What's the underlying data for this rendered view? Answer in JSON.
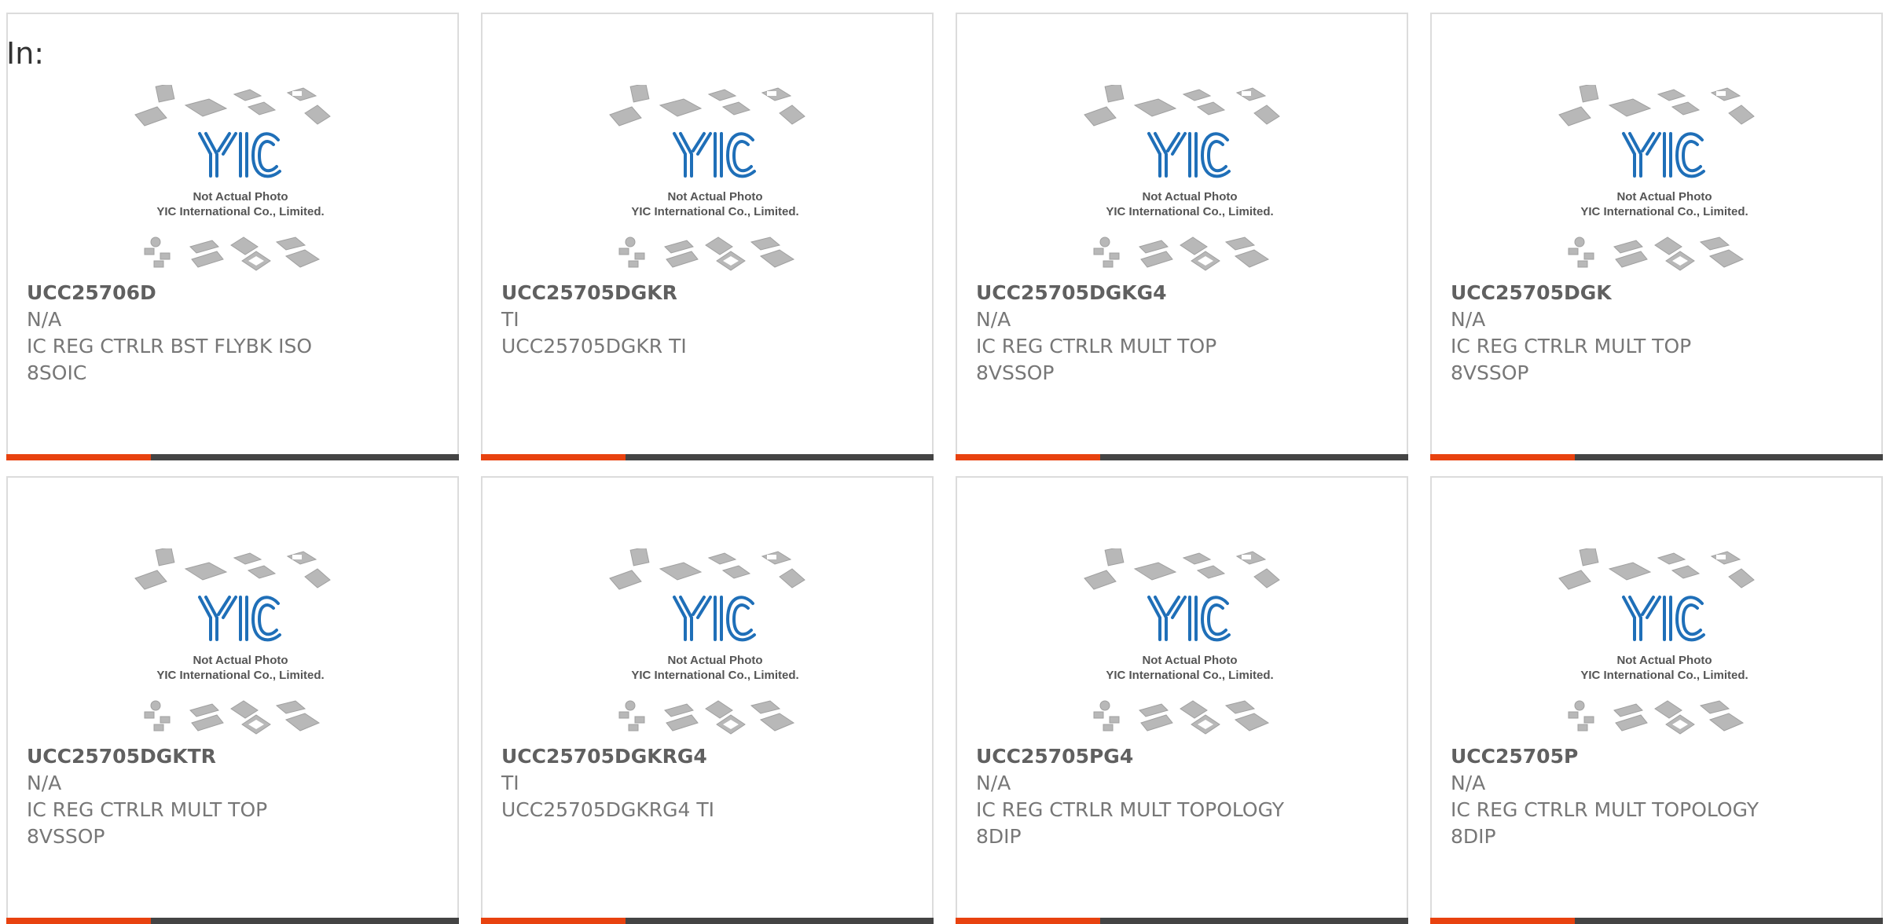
{
  "header": {
    "in_label": "In:"
  },
  "image_text": {
    "line1": "Not Actual Photo",
    "line2": "YIC International Co., Limited."
  },
  "products": [
    {
      "part": "UCC25706D",
      "manufacturer": "N/A",
      "description": "IC REG CTRLR BST FLYBK ISO",
      "package": "8SOIC"
    },
    {
      "part": "UCC25705DGKR",
      "manufacturer": "TI",
      "description": "UCC25705DGKR TI",
      "package": ""
    },
    {
      "part": "UCC25705DGKG4",
      "manufacturer": "N/A",
      "description": "IC REG CTRLR MULT TOP",
      "package": "8VSSOP"
    },
    {
      "part": "UCC25705DGK",
      "manufacturer": "N/A",
      "description": "IC REG CTRLR MULT TOP",
      "package": "8VSSOP"
    },
    {
      "part": "UCC25705DGKTR",
      "manufacturer": "N/A",
      "description": "IC REG CTRLR MULT TOP",
      "package": "8VSSOP"
    },
    {
      "part": "UCC25705DGKRG4",
      "manufacturer": "TI",
      "description": "UCC25705DGKRG4 TI",
      "package": ""
    },
    {
      "part": "UCC25705PG4",
      "manufacturer": "N/A",
      "description": "IC REG CTRLR MULT TOPOLOGY",
      "package": "8DIP"
    },
    {
      "part": "UCC25705P",
      "manufacturer": "N/A",
      "description": "IC REG CTRLR MULT TOPOLOGY",
      "package": "8DIP"
    }
  ],
  "colors": {
    "accent": "#e8420f",
    "bar": "#444444",
    "logo": "#1f6fb8"
  }
}
